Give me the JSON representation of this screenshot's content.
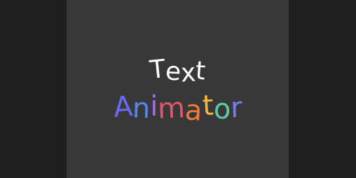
{
  "title_line1": {
    "text": "Text",
    "color": "#ffffff"
  },
  "title_line2": {
    "text": "Animator",
    "letter_colors": [
      "#6a6af0",
      "#5b82f2",
      "#a36be8",
      "#e2566e",
      "#f07a3a",
      "#f4b640",
      "#5cc9a6",
      "#7a7af2"
    ]
  },
  "colors": {
    "background": "#1e1e1e",
    "canvas": "#383838"
  }
}
